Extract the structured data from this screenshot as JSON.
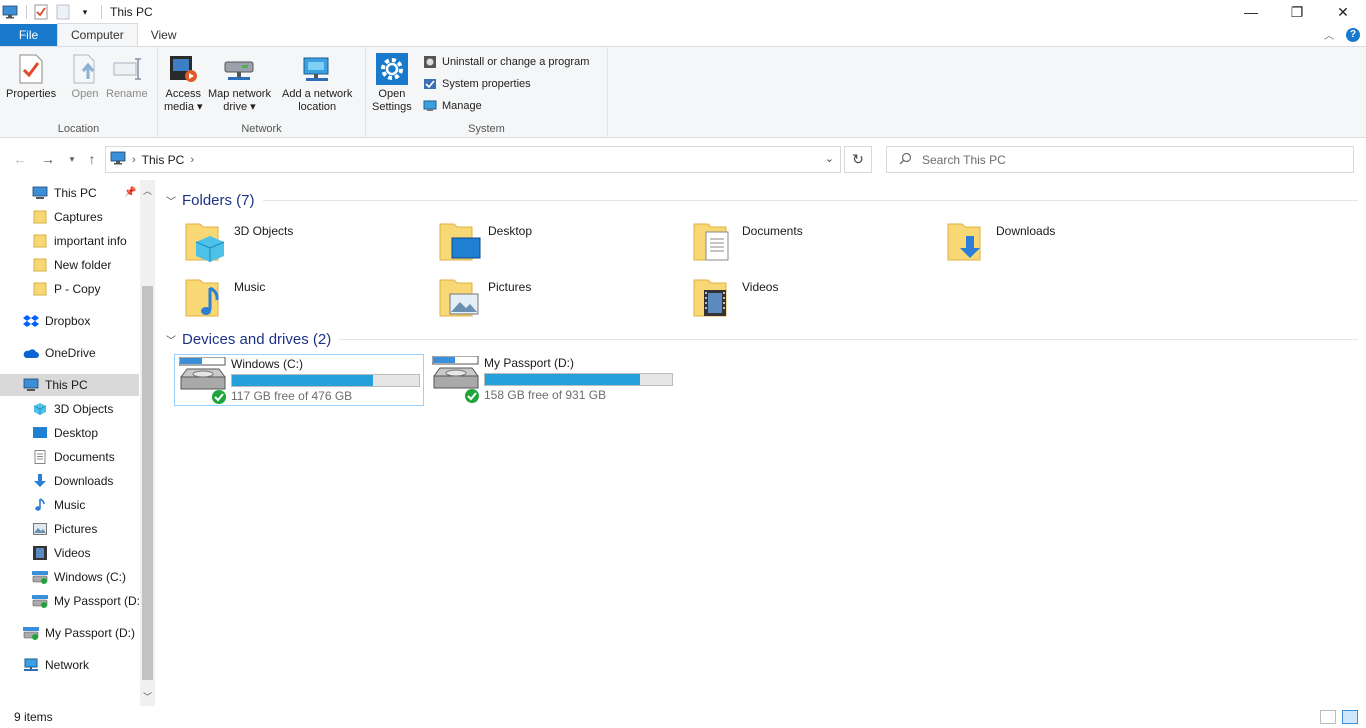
{
  "window": {
    "title": "This PC",
    "controls": {
      "minimize": "—",
      "maximize": "❐",
      "close": "✕"
    }
  },
  "ribbon": {
    "tabs": [
      {
        "label": "File"
      },
      {
        "label": "Computer"
      },
      {
        "label": "View"
      }
    ],
    "help": "?",
    "groups": {
      "location": {
        "label": "Location",
        "properties": "Properties",
        "open": "Open",
        "rename": "Rename"
      },
      "network": {
        "label": "Network",
        "access_media": [
          "Access",
          "media ▾"
        ],
        "map_drive": [
          "Map network",
          "drive ▾"
        ],
        "add_location": [
          "Add a network",
          "location"
        ]
      },
      "system": {
        "label": "System",
        "open_settings": [
          "Open",
          "Settings"
        ],
        "uninstall": "Uninstall or change a program",
        "system_properties": "System properties",
        "manage": "Manage"
      }
    }
  },
  "address": {
    "crumb": "This PC",
    "search_placeholder": "Search This PC"
  },
  "nav": {
    "items": [
      {
        "label": "This PC",
        "icon": "pc-icon",
        "pinned": true
      },
      {
        "label": "Captures",
        "icon": "folder-icon"
      },
      {
        "label": "important info",
        "icon": "folder-icon"
      },
      {
        "label": "New folder",
        "icon": "folder-icon"
      },
      {
        "label": "P - Copy",
        "icon": "folder-icon"
      },
      {
        "label": "Dropbox",
        "icon": "dropbox-icon"
      },
      {
        "label": "OneDrive",
        "icon": "onedrive-icon"
      },
      {
        "label": "This PC",
        "icon": "pc-icon",
        "selected": true
      },
      {
        "label": "3D Objects",
        "icon": "cube-icon"
      },
      {
        "label": "Desktop",
        "icon": "desktop-icon"
      },
      {
        "label": "Documents",
        "icon": "document-icon"
      },
      {
        "label": "Downloads",
        "icon": "download-icon"
      },
      {
        "label": "Music",
        "icon": "music-icon"
      },
      {
        "label": "Pictures",
        "icon": "pictures-icon"
      },
      {
        "label": "Videos",
        "icon": "videos-icon"
      },
      {
        "label": "Windows (C:)",
        "icon": "drive-icon"
      },
      {
        "label": "My Passport (D:)",
        "icon": "drive-icon"
      },
      {
        "label": "My Passport (D:)",
        "icon": "drive-icon"
      },
      {
        "label": "Network",
        "icon": "network-icon"
      }
    ]
  },
  "content": {
    "folders_header": "Folders (7)",
    "folders": [
      {
        "name": "3D Objects",
        "icon": "cube-icon"
      },
      {
        "name": "Desktop",
        "icon": "desktop-icon"
      },
      {
        "name": "Documents",
        "icon": "document-icon"
      },
      {
        "name": "Downloads",
        "icon": "download-icon"
      },
      {
        "name": "Music",
        "icon": "music-icon"
      },
      {
        "name": "Pictures",
        "icon": "pictures-icon"
      },
      {
        "name": "Videos",
        "icon": "videos-icon"
      }
    ],
    "drives_header": "Devices and drives (2)",
    "drives": [
      {
        "name": "Windows (C:)",
        "free": "117 GB free of 476 GB",
        "used_fraction": 0.754
      },
      {
        "name": "My Passport (D:)",
        "free": "158 GB free of 931 GB",
        "used_fraction": 0.83
      }
    ]
  },
  "status": {
    "count": "9 items"
  },
  "colors": {
    "accent": "#1979ca",
    "bar_fill": "#26a0da",
    "folder": "#f8d775",
    "header_text": "#1e3287"
  }
}
